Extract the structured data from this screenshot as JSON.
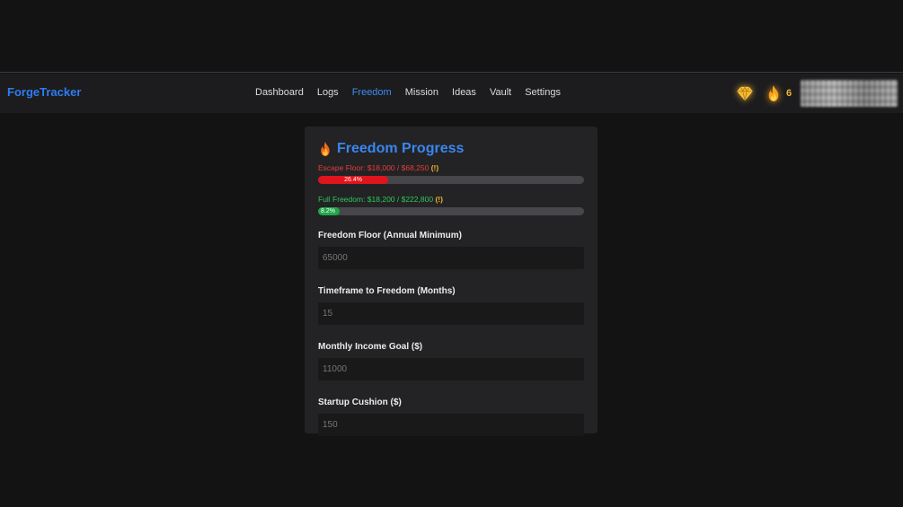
{
  "app": {
    "brand": "ForgeTracker"
  },
  "nav": {
    "items": [
      {
        "label": "Dashboard",
        "active": false
      },
      {
        "label": "Logs",
        "active": false
      },
      {
        "label": "Freedom",
        "active": true
      },
      {
        "label": "Mission",
        "active": false
      },
      {
        "label": "Ideas",
        "active": false
      },
      {
        "label": "Vault",
        "active": false
      },
      {
        "label": "Settings",
        "active": false
      }
    ],
    "streak_count": "6",
    "icons": {
      "gem": "gem-icon",
      "streak": "fire-icon"
    }
  },
  "card": {
    "title": "Freedom Progress",
    "title_icon": "fire-icon",
    "escape": {
      "label": "Escape Floor: $18,000 / $68,250",
      "warning": "(!)",
      "percent_text": "26.4%",
      "percent": 26.4,
      "color": "#e0141c"
    },
    "full": {
      "label": "Full Freedom: $18,200 / $222,800",
      "warning": "(!)",
      "percent_text": "8.2%",
      "percent": 8.2,
      "color": "#1fa847"
    },
    "fields": {
      "floor": {
        "label": "Freedom Floor (Annual Minimum)",
        "placeholder": "65000"
      },
      "timeframe": {
        "label": "Timeframe to Freedom (Months)",
        "placeholder": "15"
      },
      "income": {
        "label": "Monthly Income Goal ($)",
        "placeholder": "11000"
      },
      "cushion": {
        "label": "Startup Cushion ($)",
        "placeholder": "150"
      }
    }
  }
}
